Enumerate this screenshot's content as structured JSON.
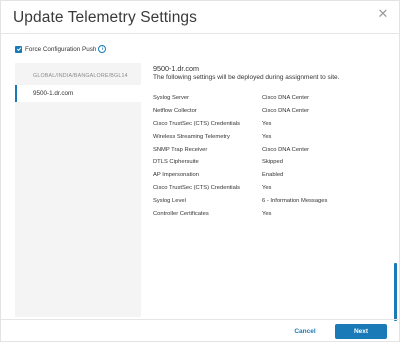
{
  "dialog": {
    "title": "Update Telemetry Settings",
    "close_icon": "close-icon"
  },
  "force_push": {
    "label": "Force Configuration Push",
    "checked": true,
    "info_icon": "info-icon"
  },
  "tree": {
    "header": "GLOBAL/INDIA/BANGALORE/BGL14",
    "items": [
      {
        "label": "9500-1.dr.com",
        "selected": true
      }
    ]
  },
  "detail": {
    "device": "9500-1.dr.com",
    "description": "The following settings will be deployed during assignment to site.",
    "settings": [
      {
        "key": "Syslog Server",
        "value": "Cisco DNA Center"
      },
      {
        "key": "Netflow Collector",
        "value": "Cisco DNA Center"
      },
      {
        "key": "Cisco TrustSec (CTS) Credentials",
        "value": "Yes"
      },
      {
        "key": "Wireless Streaming Telemetry",
        "value": "Yes"
      },
      {
        "key": "SNMP Trap Receiver",
        "value": "Cisco DNA Center"
      },
      {
        "key": "DTLS Ciphersuite",
        "value": "Skipped"
      },
      {
        "key": "AP Impersonation",
        "value": "Enabled"
      },
      {
        "key": "Cisco TrustSec (CTS) Credentials",
        "value": "Yes"
      },
      {
        "key": "Syslog Level",
        "value": "6 - Information Messages"
      },
      {
        "key": "Controller Certificates",
        "value": "Yes"
      }
    ]
  },
  "footer": {
    "cancel_label": "Cancel",
    "next_label": "Next"
  },
  "colors": {
    "accent": "#1a7ab8",
    "panel_bg": "#f4f4f4"
  }
}
